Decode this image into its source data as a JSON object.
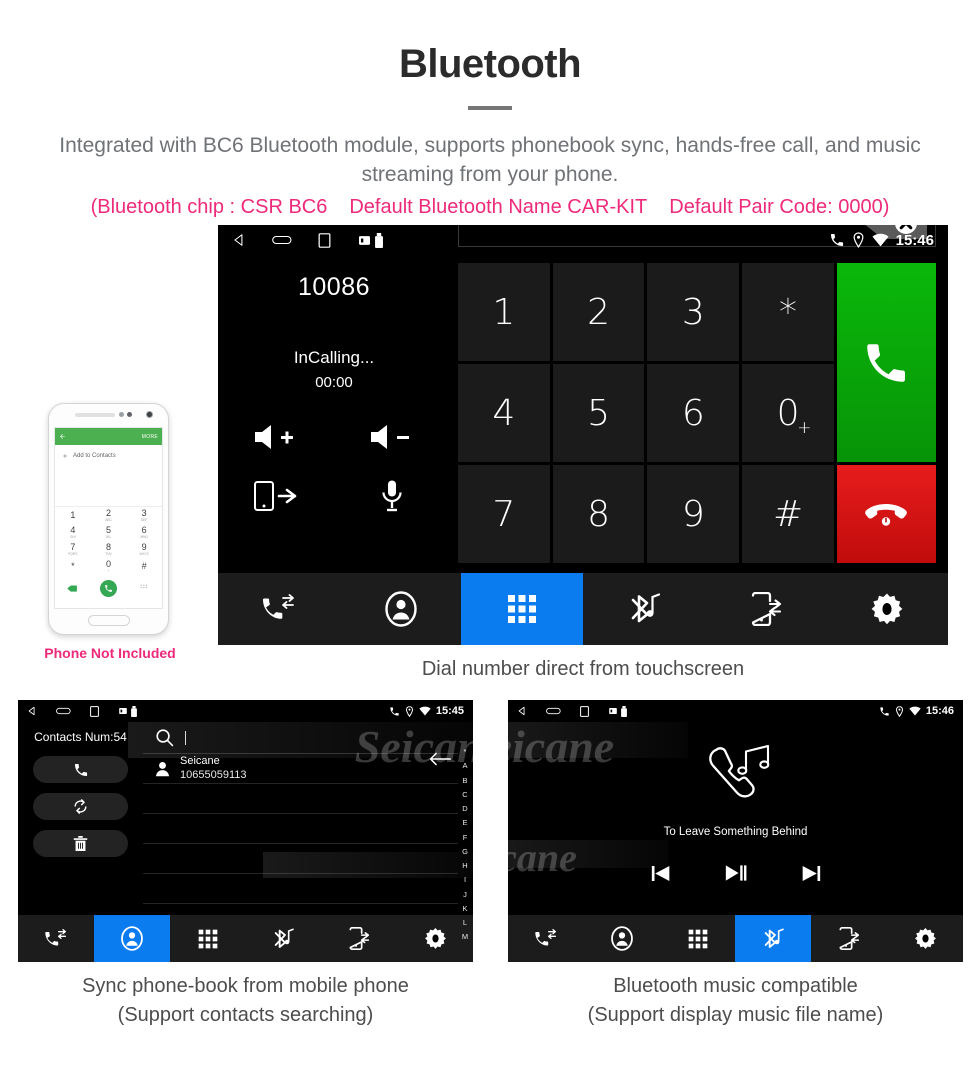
{
  "header": {
    "title": "Bluetooth",
    "subtitle": "Integrated with BC6 Bluetooth module, supports phonebook sync, hands-free call, and music streaming from your phone.",
    "spec_open": "(Bluetooth chip : CSR BC6",
    "spec_name": "Default Bluetooth Name CAR-KIT",
    "spec_pair": "Default Pair Code: 0000)",
    "accent_color": "#ee2a7b",
    "title_color": "#2b2b2b",
    "subtitle_color": "#6f7276"
  },
  "captions": {
    "dialer": "Dial number direct from touchscreen",
    "contacts_line1": "Sync phone-book from mobile phone",
    "contacts_line2": "(Support contacts searching)",
    "music_line1": "Bluetooth music compatible",
    "music_line2": "(Support display music file name)"
  },
  "phone_mock": {
    "header_back": "back-arrow",
    "header_more": "MORE",
    "add_contacts": "Add to Contacts",
    "keys": [
      {
        "digit": "1",
        "letters": ""
      },
      {
        "digit": "2",
        "letters": "ABC"
      },
      {
        "digit": "3",
        "letters": "DEF"
      },
      {
        "digit": "4",
        "letters": "GHI"
      },
      {
        "digit": "5",
        "letters": "JKL"
      },
      {
        "digit": "6",
        "letters": "MNO"
      },
      {
        "digit": "7",
        "letters": "PQRS"
      },
      {
        "digit": "8",
        "letters": "TUV"
      },
      {
        "digit": "9",
        "letters": "WXYZ"
      },
      {
        "digit": "*",
        "letters": ""
      },
      {
        "digit": "0",
        "letters": "+"
      },
      {
        "digit": "#",
        "letters": ""
      }
    ],
    "not_included_note": "Phone Not Included",
    "note_color": "#ee2a7b"
  },
  "dialer_screen": {
    "statusbar": {
      "back_icon": "back-triangle-icon",
      "home_icon": "home-pill-icon",
      "recents_icon": "recents-square-icon",
      "sd_icon": "sd-card-icon",
      "usb_icon": "usb-drive-icon",
      "phone_icon": "phone-icon",
      "location_icon": "location-pin-icon",
      "wifi_icon": "wifi-icon",
      "time": "15:46"
    },
    "dialed_number": "10086",
    "call_status": "InCalling...",
    "call_timer": "00:00",
    "side_icons": [
      {
        "name": "volume-up-icon",
        "label": "Volume Up"
      },
      {
        "name": "volume-down-icon",
        "label": "Volume Down"
      },
      {
        "name": "transfer-to-phone-icon",
        "label": "Transfer To Phone"
      },
      {
        "name": "microphone-mute-icon",
        "label": "Microphone"
      }
    ],
    "input_value": "",
    "backspace_icon": "backspace-clear-icon",
    "keypad": [
      "1",
      "2",
      "3",
      "*",
      "4",
      "5",
      "6",
      "0",
      "7",
      "8",
      "9",
      "#"
    ],
    "zero_plus": "+",
    "call_button_icon": "call-handset-icon",
    "end_button_icon": "end-call-handset-icon",
    "call_button_color": "#0ab80a",
    "end_button_color": "#e81c1c"
  },
  "contacts_screen": {
    "statusbar": {
      "time": "15:45"
    },
    "contacts_count_label": "Contacts Num:54",
    "actions": [
      {
        "name": "call-button",
        "icon": "phone-handset-icon"
      },
      {
        "name": "sync-button",
        "icon": "refresh-sync-icon"
      },
      {
        "name": "delete-button",
        "icon": "trash-bin-icon"
      }
    ],
    "search_placeholder": "",
    "search_icon": "search-magnifier-icon",
    "back_icon": "back-arrow-icon",
    "contact": {
      "name": "Seicane",
      "number": "10655059113",
      "avatar": "contact-avatar-icon"
    },
    "alpha_index": [
      "*",
      "A",
      "B",
      "C",
      "D",
      "E",
      "F",
      "G",
      "H",
      "I",
      "J",
      "K",
      "L",
      "M"
    ],
    "watermark": "Seicane"
  },
  "music_screen": {
    "statusbar": {
      "time": "15:46"
    },
    "album_icon": "handset-music-note-icon",
    "track_title": "To Leave Something Behind",
    "controls": [
      {
        "name": "previous-track-button",
        "icon": "previous-icon"
      },
      {
        "name": "play-pause-button",
        "icon": "play-pause-icon"
      },
      {
        "name": "next-track-button",
        "icon": "next-icon"
      }
    ],
    "watermark": "Seicane"
  },
  "navbar": {
    "active_color": "#0a7cf0",
    "items": [
      {
        "name": "call-history",
        "icon": "call-log-icon"
      },
      {
        "name": "contacts",
        "icon": "contact-person-icon"
      },
      {
        "name": "keypad",
        "icon": "dialpad-grid-icon"
      },
      {
        "name": "bluetooth-music",
        "icon": "bluetooth-music-icon"
      },
      {
        "name": "phone-link",
        "icon": "phone-link-icon"
      },
      {
        "name": "settings",
        "icon": "gear-icon"
      }
    ],
    "active_dialer": 2,
    "active_contacts": 1,
    "active_music": 3
  }
}
